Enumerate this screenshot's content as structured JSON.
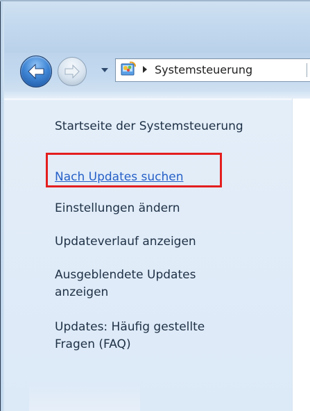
{
  "navigation": {
    "breadcrumb": [
      "Systemsteuerung"
    ]
  },
  "sidebar": {
    "home_link": "Startseite der Systemsteuerung",
    "tasks": [
      {
        "label": "Nach Updates suchen",
        "active": true,
        "highlighted": true
      },
      {
        "label": "Einstellungen ändern",
        "active": false
      },
      {
        "label": "Updateverlauf anzeigen",
        "active": false
      },
      {
        "label_lines": [
          "Ausgeblendete Updates",
          "anzeigen"
        ],
        "active": false
      },
      {
        "label_lines": [
          "Updates: Häufig gestellte",
          "Fragen (FAQ)"
        ],
        "active": false
      }
    ]
  },
  "icons": {
    "back": "back-arrow-icon",
    "forward": "forward-arrow-icon",
    "history": "chevron-down-icon",
    "location": "control-panel-icon",
    "crumb_separator": "chevron-right-icon"
  },
  "colors": {
    "link_active": "#2660c7",
    "link_text": "#1e3045",
    "highlight_border": "#e41e1e",
    "sidebar_background": "#dce9f7",
    "nav_background": "#c3d9ef"
  }
}
